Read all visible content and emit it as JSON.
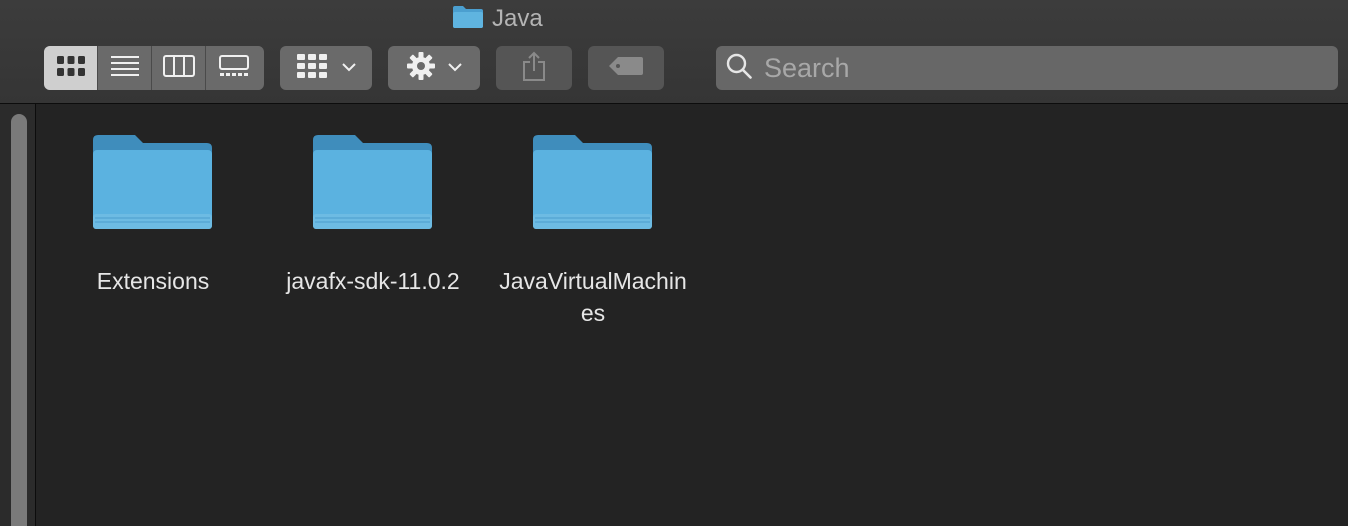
{
  "window": {
    "title": "Java"
  },
  "toolbar": {
    "view_modes": [
      {
        "name": "icon-view",
        "icon": "grid-icon",
        "active": true
      },
      {
        "name": "list-view",
        "icon": "list-icon",
        "active": false
      },
      {
        "name": "column-view",
        "icon": "columns-icon",
        "active": false
      },
      {
        "name": "gallery-view",
        "icon": "gallery-icon",
        "active": false
      }
    ],
    "group_button": {
      "icon": "group-grid-icon",
      "has_dropdown": true
    },
    "action_button": {
      "icon": "gear-icon",
      "has_dropdown": true
    },
    "share_button": {
      "icon": "share-icon",
      "disabled": true
    },
    "tag_button": {
      "icon": "tag-icon",
      "disabled": true
    }
  },
  "search": {
    "placeholder": "Search",
    "value": ""
  },
  "items": [
    {
      "label": "Extensions",
      "icon": "folder-icon"
    },
    {
      "label": "javafx-sdk-11.0.2",
      "icon": "folder-icon"
    },
    {
      "label": "JavaVirtualMachines",
      "icon": "folder-icon"
    }
  ],
  "colors": {
    "folder_top": "#4b9fd0",
    "folder_body": "#5fb4e0",
    "toolbar": "#3a3a3a",
    "content_bg": "#232323"
  }
}
